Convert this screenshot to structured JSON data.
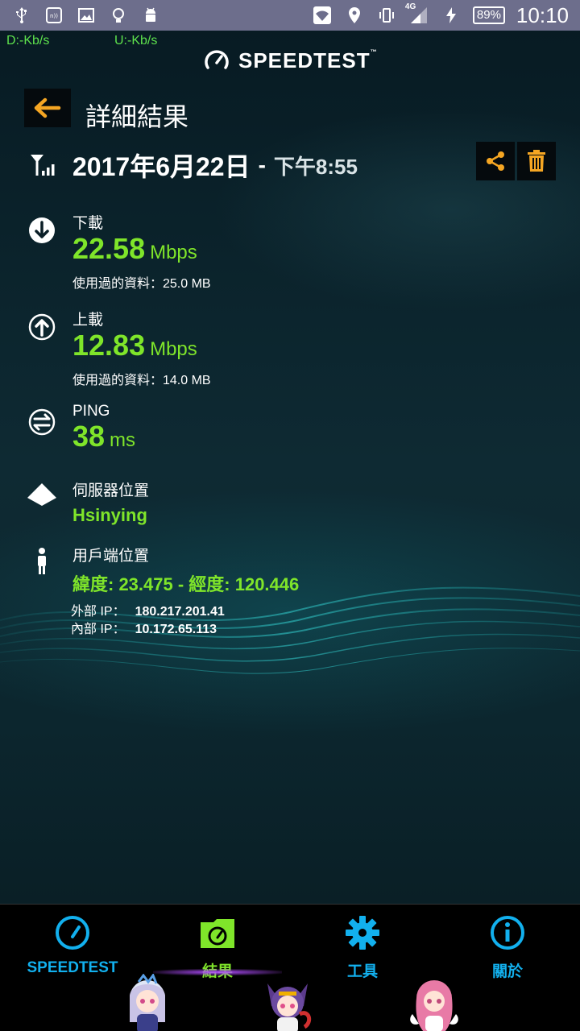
{
  "status_bar": {
    "battery": "89%",
    "network": "4G",
    "time": "10:10"
  },
  "speed_meter": {
    "download": "D:-Kb/s",
    "upload": "U:-Kb/s"
  },
  "brand": {
    "name": "SPEEDTEST",
    "tm": "™"
  },
  "header": {
    "title": "詳細結果"
  },
  "result": {
    "date": "2017年6月22日",
    "separator": "-",
    "time": "下午8:55"
  },
  "download": {
    "label": "下載",
    "value": "22.58",
    "unit": "Mbps",
    "data_used": "使用過的資料：25.0 MB"
  },
  "upload": {
    "label": "上載",
    "value": "12.83",
    "unit": "Mbps",
    "data_used": "使用過的資料：14.0 MB"
  },
  "ping": {
    "label": "PING",
    "value": "38",
    "unit": "ms"
  },
  "server": {
    "label": "伺服器位置",
    "value": "Hsinying"
  },
  "client": {
    "label": "用戶端位置",
    "value": "緯度: 23.475 - 經度: 120.446"
  },
  "ip": {
    "external_label": "外部 IP：",
    "external_value": "180.217.201.41",
    "internal_label": "內部 IP：",
    "internal_value": "10.172.65.113"
  },
  "nav": {
    "items": [
      {
        "label": "SPEEDTEST",
        "icon": "speedometer-icon"
      },
      {
        "label": "結果",
        "icon": "results-folder-icon",
        "active": true
      },
      {
        "label": "工具",
        "icon": "gear-icon"
      },
      {
        "label": "關於",
        "icon": "info-icon"
      }
    ]
  },
  "colors": {
    "accent_green": "#7fe52a",
    "accent_blue": "#12b0ee",
    "accent_orange": "#f5a623",
    "status_bar": "#6d6e8c"
  }
}
